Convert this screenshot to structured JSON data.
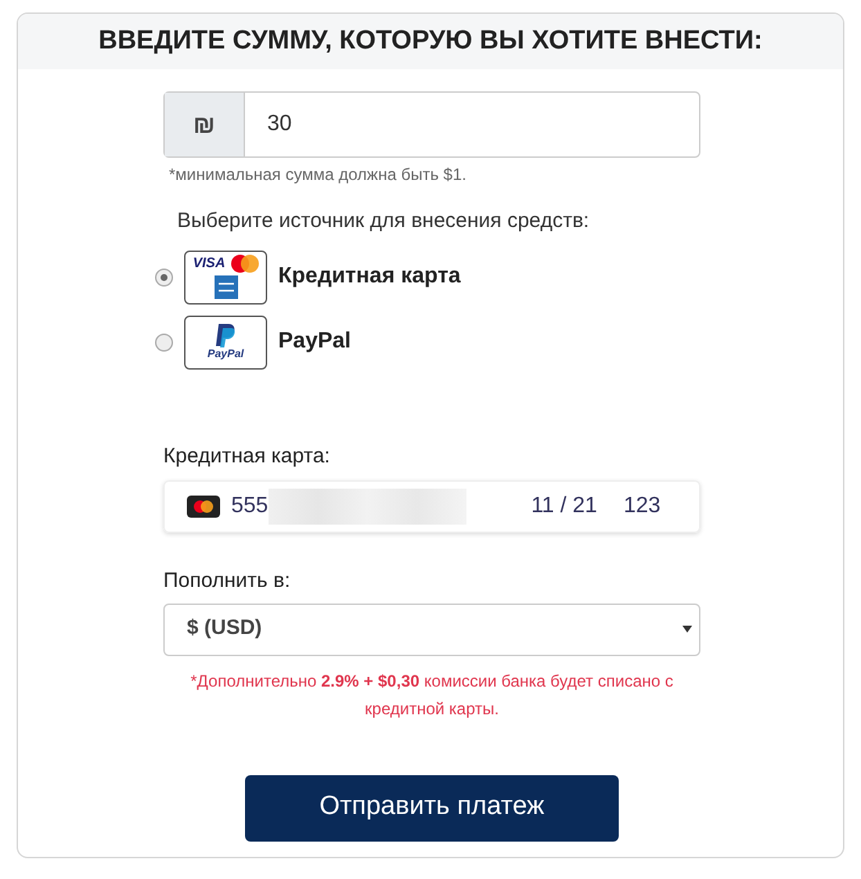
{
  "title": "ВВЕДИТЕ СУММУ, КОТОРУЮ ВЫ ХОТИТЕ ВНЕСТИ:",
  "amount": {
    "currency_symbol": "₪",
    "value": "30",
    "hint": "*минимальная сумма должна быть $1."
  },
  "source": {
    "label": "Выберите источник для внесения средств:",
    "options": [
      {
        "kind": "card",
        "label": "Кредитная карта",
        "logo_text": "VISA",
        "selected": true
      },
      {
        "kind": "paypal",
        "label": "PayPal",
        "logo_text": "PayPal",
        "selected": false
      }
    ]
  },
  "card": {
    "label": "Кредитная карта:",
    "number_visible": "555",
    "expiry": "11 / 21",
    "cvc": "123"
  },
  "deposit": {
    "label": "Пополнить в:",
    "value": "$ (USD)"
  },
  "fee_note": "*Дополнительно **2.9% + $0,30** комиссии банка будет списано с кредитной карты.",
  "submit": "Отправить платеж"
}
